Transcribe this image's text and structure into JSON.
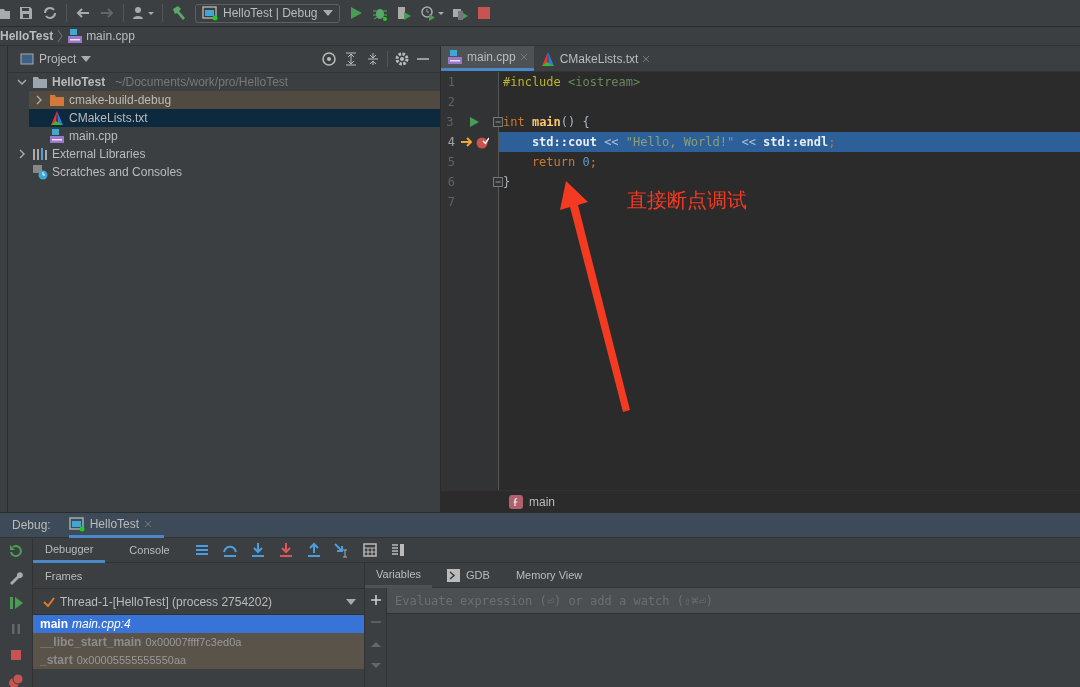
{
  "toolbar": {
    "run_config": "HelloTest | Debug"
  },
  "breadcrumb": [
    {
      "label": "HelloTest",
      "kind": "project"
    },
    {
      "label": "main.cpp",
      "kind": "cpp"
    }
  ],
  "project_panel": {
    "title": "Project",
    "tree": [
      {
        "label": "HelloTest",
        "path": "~/Documents/work/pro/HelloTest",
        "kind": "folder",
        "expanded": true,
        "selected": false,
        "children": [
          {
            "label": "cmake-build-debug",
            "kind": "build-folder",
            "expanded": false,
            "selected": false
          },
          {
            "label": "CMakeLists.txt",
            "kind": "cmake",
            "selected": true
          },
          {
            "label": "main.cpp",
            "kind": "cpp",
            "selected": false
          }
        ]
      },
      {
        "label": "External Libraries",
        "kind": "libraries",
        "expanded": false,
        "selected": false
      },
      {
        "label": "Scratches and Consoles",
        "kind": "scratches",
        "selected": false
      }
    ]
  },
  "editor": {
    "tabs": [
      {
        "label": "main.cpp",
        "kind": "cpp",
        "selected": true
      },
      {
        "label": "CMakeLists.txt",
        "kind": "cmake",
        "selected": false
      }
    ],
    "lines": [
      {
        "number": "1",
        "run": false,
        "breakpoint": false,
        "fold": false,
        "current": false,
        "tokens": [
          {
            "kind": "macro",
            "text": "#include"
          },
          {
            "kind": "string",
            "text": " <iostream>"
          }
        ]
      },
      {
        "number": "2",
        "run": false,
        "breakpoint": false,
        "fold": false,
        "current": false
      },
      {
        "number": "3",
        "run": true,
        "breakpoint": false,
        "fold": true,
        "current": false,
        "tokens": [
          {
            "kind": "keyword",
            "text": "int"
          },
          {
            "kind": "function",
            "text": " main"
          },
          {
            "kind": "plain",
            "text": "() {"
          }
        ]
      },
      {
        "number": "4",
        "run": false,
        "breakpoint": true,
        "fold": false,
        "current": true,
        "tokens": [
          {
            "kind": "plain",
            "text": "    std::cout"
          },
          {
            "kind": "operator",
            "text": " << "
          },
          {
            "kind": "string",
            "text": "\"Hello, World!\""
          },
          {
            "kind": "operator",
            "text": " << "
          },
          {
            "kind": "plain",
            "text": "std::endl"
          },
          {
            "kind": "keyword",
            "text": ";"
          }
        ]
      },
      {
        "number": "5",
        "run": false,
        "breakpoint": false,
        "fold": false,
        "current": false,
        "tokens": [
          {
            "kind": "keyword",
            "text": "    return"
          },
          {
            "kind": "number",
            "text": " 0"
          },
          {
            "kind": "keyword",
            "text": ";"
          }
        ]
      },
      {
        "number": "6",
        "run": false,
        "breakpoint": false,
        "fold": true,
        "current": false,
        "tokens": [
          {
            "kind": "plain",
            "text": "}"
          }
        ]
      },
      {
        "number": "7",
        "run": false,
        "breakpoint": false,
        "fold": false,
        "current": false
      }
    ],
    "function_breadcrumb": "main",
    "annotation": "直接断点调试"
  },
  "debug": {
    "title": "Debug:",
    "session": "HelloTest",
    "tabs": [
      {
        "label": "Debugger",
        "selected": true
      },
      {
        "label": "Console",
        "selected": false
      }
    ],
    "frames_title": "Frames",
    "thread": "Thread-1-[HelloTest] (process 2754202)",
    "frames": [
      {
        "function": "main",
        "location": "main.cpp:4",
        "kind": "user",
        "selected": true
      },
      {
        "function": "__libc_start_main",
        "location": "0x00007ffff7c3ed0a",
        "kind": "library",
        "selected": false
      },
      {
        "function": "_start",
        "location": "0x00005555555550aa",
        "kind": "library",
        "selected": false
      }
    ],
    "variable_tabs": [
      {
        "label": "Variables",
        "kind": "plain",
        "selected": true
      },
      {
        "label": "GDB",
        "kind": "console",
        "selected": false
      },
      {
        "label": "Memory View",
        "kind": "plain",
        "selected": false
      }
    ],
    "watch_placeholder": "Evaluate expression (⏎) or add a watch (⇧⌘⏎)"
  }
}
